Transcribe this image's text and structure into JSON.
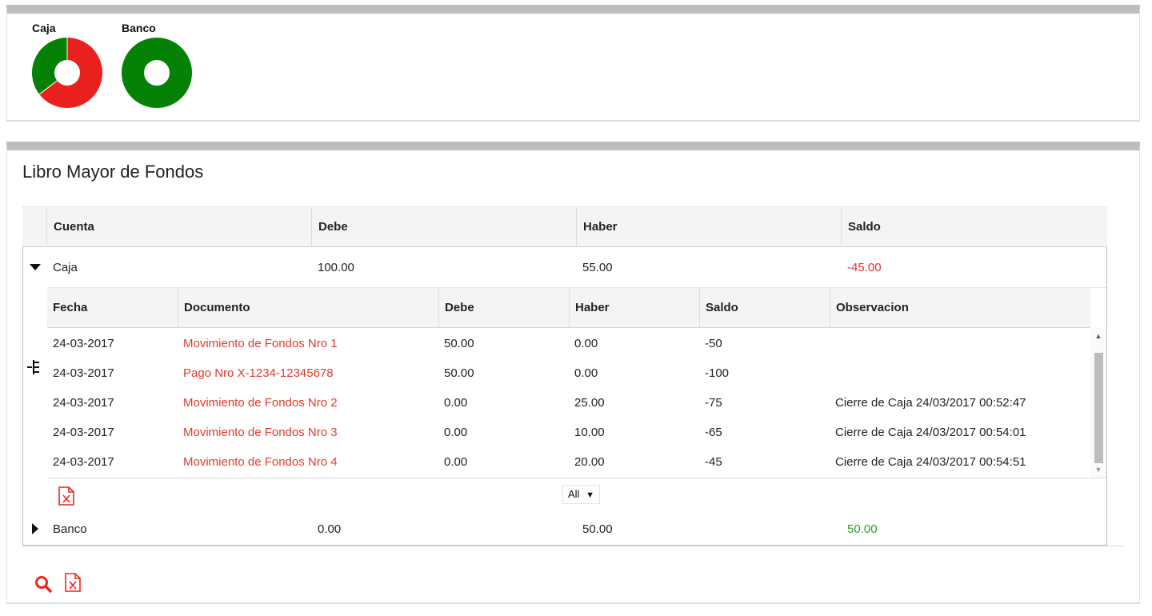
{
  "charts": {
    "caja": {
      "label": "Caja",
      "debe": 100.0,
      "haber": 55.0,
      "colors": {
        "debe": "#e8211f",
        "haber": "#058105"
      }
    },
    "banco": {
      "label": "Banco",
      "debe": 0.0,
      "haber": 50.0,
      "colors": {
        "debe": "#e8211f",
        "haber": "#058105"
      }
    }
  },
  "ledger": {
    "title": "Libro Mayor de Fondos",
    "columns": [
      "Cuenta",
      "Debe",
      "Haber",
      "Saldo"
    ],
    "accounts": [
      {
        "cuenta": "Caja",
        "debe": "100.00",
        "haber": "55.00",
        "saldo": "-45.00",
        "expanded": true
      },
      {
        "cuenta": "Banco",
        "debe": "0.00",
        "haber": "50.00",
        "saldo": "50.00",
        "expanded": false
      }
    ],
    "detail": {
      "columns": [
        "Fecha",
        "Documento",
        "Debe",
        "Haber",
        "Saldo",
        "Observacion"
      ],
      "rows": [
        {
          "fecha": "24-03-2017",
          "documento": "Movimiento de Fondos Nro 1",
          "debe": "50.00",
          "haber": "0.00",
          "saldo": "-50",
          "observacion": ""
        },
        {
          "fecha": "24-03-2017",
          "documento": "Pago Nro X-1234-12345678",
          "debe": "50.00",
          "haber": "0.00",
          "saldo": "-100",
          "observacion": ""
        },
        {
          "fecha": "24-03-2017",
          "documento": "Movimiento de Fondos Nro 2",
          "debe": "0.00",
          "haber": "25.00",
          "saldo": "-75",
          "observacion": "Cierre de Caja 24/03/2017 00:52:47"
        },
        {
          "fecha": "24-03-2017",
          "documento": "Movimiento de Fondos Nro 3",
          "debe": "0.00",
          "haber": "10.00",
          "saldo": "-65",
          "observacion": "Cierre de Caja 24/03/2017 00:54:01"
        },
        {
          "fecha": "24-03-2017",
          "documento": "Movimiento de Fondos Nro 4",
          "debe": "0.00",
          "haber": "20.00",
          "saldo": "-45",
          "observacion": "Cierre de Caja 24/03/2017 00:54:51"
        }
      ],
      "page_size": "All"
    }
  },
  "icons": {
    "expand_open": "triangle-down-icon",
    "expand_closed": "triangle-right-icon",
    "tree": "tree-icon",
    "excel": "excel-file-icon",
    "search": "search-icon"
  },
  "colors": {
    "negative": "#e52b2b",
    "positive": "#2e9a2e",
    "link": "#e03a2c",
    "accent_icon": "#e8291c"
  }
}
